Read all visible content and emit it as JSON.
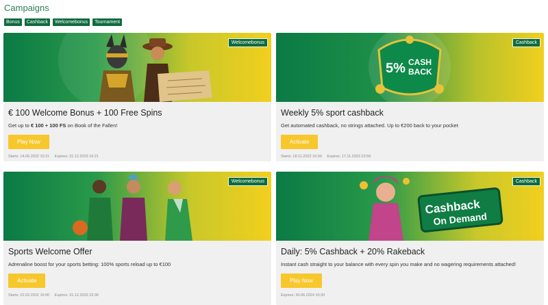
{
  "page": {
    "title": "Campaigns",
    "filters": [
      "Bonus",
      "Cashback",
      "Welcomebonus",
      "Tournament"
    ]
  },
  "cards": [
    {
      "badge": "Welcomebonus",
      "title": "€ 100 Welcome Bonus + 100 Free Spins",
      "desc_pre": "Get up to ",
      "desc_bold": "€ 100 + 100 FS",
      "desc_post": " on Book of the Fallen!",
      "cta": "Play Now",
      "starts": "Starts: 14.06.2022 10:21",
      "expires": "Expires: 31.12.2023 10:21"
    },
    {
      "badge": "Cashback",
      "title": "Weekly 5% sport cashback",
      "desc": "Get automated cashback, no strings attached. Up to €200 back to your pocket",
      "cta": "Activate",
      "starts": "Starts: 18.11.2022 16:00",
      "expires": "Expires: 17.11.2023 23:59",
      "banner_text_1": "5%",
      "banner_text_2": "CASH",
      "banner_text_3": "BACK"
    },
    {
      "badge": "Welcomebonus",
      "title": "Sports Welcome Offer",
      "desc": "Adrenaline boost for your sports betting: 100% sports reload up to €100",
      "cta": "Activate",
      "starts": "Starts: 22.02.2022 10:00",
      "expires": "Expires: 31.12.2023 23:30"
    },
    {
      "badge": "Cashback",
      "title": "Daily: 5% Cashback + 20% Rakeback",
      "desc": "Instant cash straight to your balance with every spin you make and no wagering requirements attached!",
      "cta": "Play Now",
      "expires": "Expires: 30.06.2024 10:33",
      "banner_text_1": "Cashback",
      "banner_text_2": "On Demand"
    }
  ],
  "colors": {
    "brand_green": "#0f6b3e",
    "title_green": "#2e7d55",
    "cta_yellow": "#f7c72c"
  }
}
